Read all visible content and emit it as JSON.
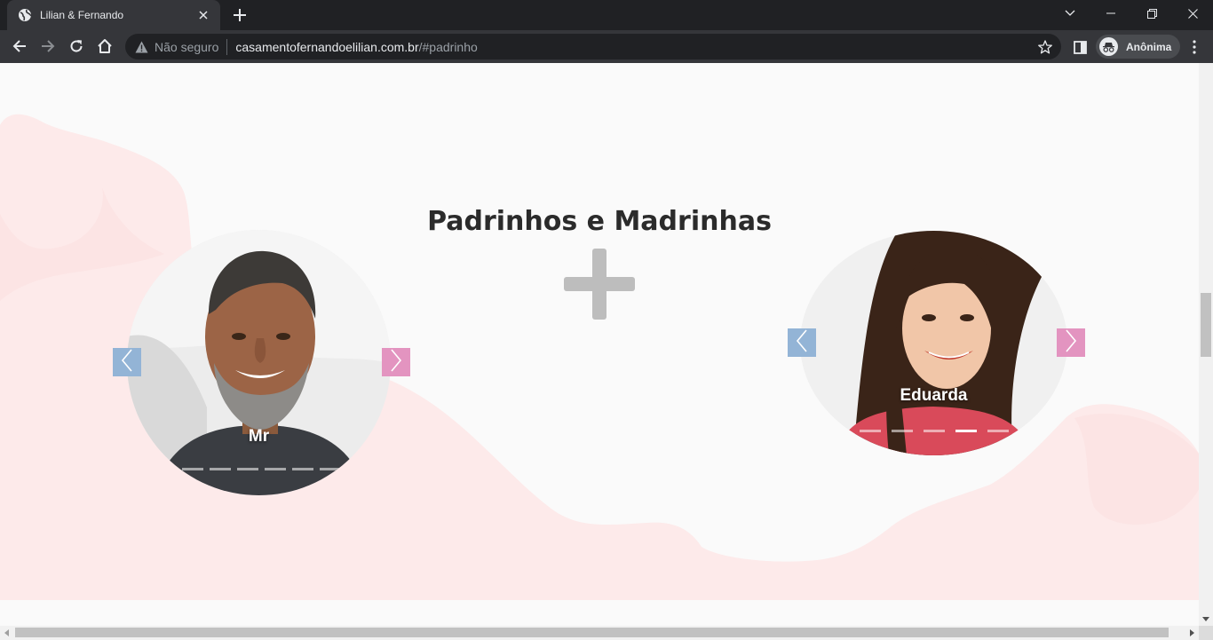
{
  "browser": {
    "tab_title": "Lilian & Fernando",
    "omnibox": {
      "security_label": "Não seguro",
      "host": "casamentofernandoelilian.com.br",
      "path": "/#padrinho"
    },
    "profile_label": "Anônima"
  },
  "page": {
    "section_title": "Padrinhos e Madrinhas",
    "carousels": [
      {
        "side": "padrinho",
        "current_name": "Mr",
        "slide_count": 8,
        "active_index": 7
      },
      {
        "side": "madrinha",
        "current_name": "Eduarda",
        "slide_count": 6,
        "active_index": 3
      }
    ]
  },
  "colors": {
    "accent_blue": "#93b4d6",
    "accent_pink": "#e394c0",
    "blob_pink": "#fdeaea",
    "plus_grey": "#bdbdbd"
  },
  "icons": [
    "globe-icon",
    "close-icon",
    "plus-icon",
    "chevron-down-icon",
    "minimize-icon",
    "restore-icon",
    "back-icon",
    "forward-icon",
    "reload-icon",
    "home-icon",
    "warning-icon",
    "star-icon",
    "side-panel-icon",
    "incognito-icon",
    "kebab-menu-icon",
    "chevron-left-icon",
    "chevron-right-icon"
  ]
}
